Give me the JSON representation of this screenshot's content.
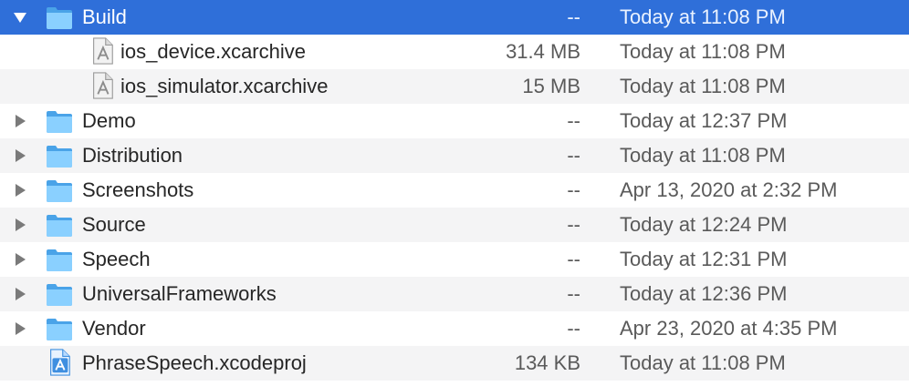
{
  "colors": {
    "selection": "#2f6fd9",
    "folder": "#5fb5f0",
    "alt_row": "#f4f4f5"
  },
  "rows": [
    {
      "name": "Build",
      "size": "--",
      "date": "Today at 11:08 PM",
      "icon": "folder-icon",
      "disclosure": "expanded"
    },
    {
      "name": "ios_device.xcarchive",
      "size": "31.4 MB",
      "date": "Today at 11:08 PM",
      "icon": "xcarchive-file-icon"
    },
    {
      "name": "ios_simulator.xcarchive",
      "size": "15 MB",
      "date": "Today at 11:08 PM",
      "icon": "xcarchive-file-icon"
    },
    {
      "name": "Demo",
      "size": "--",
      "date": "Today at 12:37 PM",
      "icon": "folder-icon",
      "disclosure": "collapsed"
    },
    {
      "name": "Distribution",
      "size": "--",
      "date": "Today at 11:08 PM",
      "icon": "folder-icon",
      "disclosure": "collapsed"
    },
    {
      "name": "Screenshots",
      "size": "--",
      "date": "Apr 13, 2020 at 2:32 PM",
      "icon": "folder-icon",
      "disclosure": "collapsed"
    },
    {
      "name": "Source",
      "size": "--",
      "date": "Today at 12:24 PM",
      "icon": "folder-icon",
      "disclosure": "collapsed"
    },
    {
      "name": "Speech",
      "size": "--",
      "date": "Today at 12:31 PM",
      "icon": "folder-icon",
      "disclosure": "collapsed"
    },
    {
      "name": "UniversalFrameworks",
      "size": "--",
      "date": "Today at 12:36 PM",
      "icon": "folder-icon",
      "disclosure": "collapsed"
    },
    {
      "name": "Vendor",
      "size": "--",
      "date": "Apr 23, 2020 at 4:35 PM",
      "icon": "folder-icon",
      "disclosure": "collapsed"
    },
    {
      "name": "PhraseSpeech.xcodeproj",
      "size": "134 KB",
      "date": "Today at 11:08 PM",
      "icon": "xcodeproj-file-icon"
    }
  ]
}
